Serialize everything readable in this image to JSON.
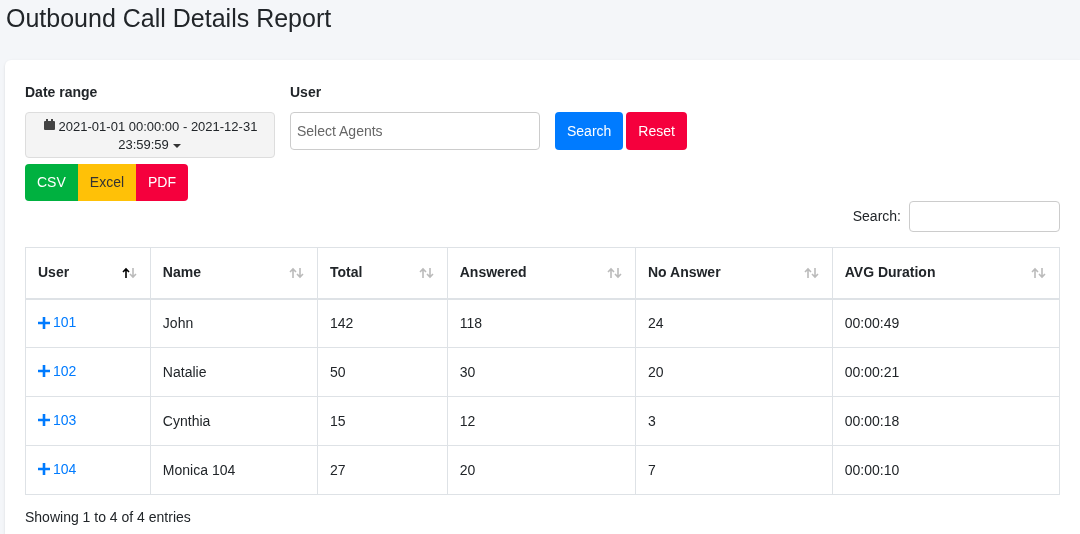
{
  "page_title": "Outbound Call Details Report",
  "filters": {
    "date_range": {
      "label": "Date range",
      "value": "2021-01-01 00:00:00 - 2021-12-31 23:59:59"
    },
    "user": {
      "label": "User",
      "placeholder": "Select Agents"
    },
    "buttons": [
      {
        "label": "Search",
        "kind": "primary"
      },
      {
        "label": "Reset",
        "kind": "danger"
      }
    ]
  },
  "export_buttons": [
    {
      "label": "CSV",
      "color": "#00b140"
    },
    {
      "label": "Excel",
      "color": "#ffc107"
    },
    {
      "label": "PDF",
      "color": "#f5003d"
    }
  ],
  "search": {
    "label": "Search:"
  },
  "table": {
    "columns": [
      {
        "label": "User",
        "sorted_ascending": true
      },
      {
        "label": "Name",
        "sorted_ascending": false
      },
      {
        "label": "Total",
        "sorted_ascending": false
      },
      {
        "label": "Answered",
        "sorted_ascending": false
      },
      {
        "label": "No Answer",
        "sorted_ascending": false
      },
      {
        "label": "AVG Duration",
        "sorted_ascending": false
      }
    ],
    "rows": [
      [
        "101",
        "John",
        "142",
        "118",
        "24",
        "00:00:49"
      ],
      [
        "102",
        "Natalie",
        "50",
        "30",
        "20",
        "00:00:21"
      ],
      [
        "103",
        "Cynthia",
        "15",
        "12",
        "3",
        "00:00:18"
      ],
      [
        "104",
        "Monica 104",
        "27",
        "20",
        "7",
        "00:00:10"
      ]
    ]
  },
  "footer": "Showing 1 to 4 of 4 entries"
}
